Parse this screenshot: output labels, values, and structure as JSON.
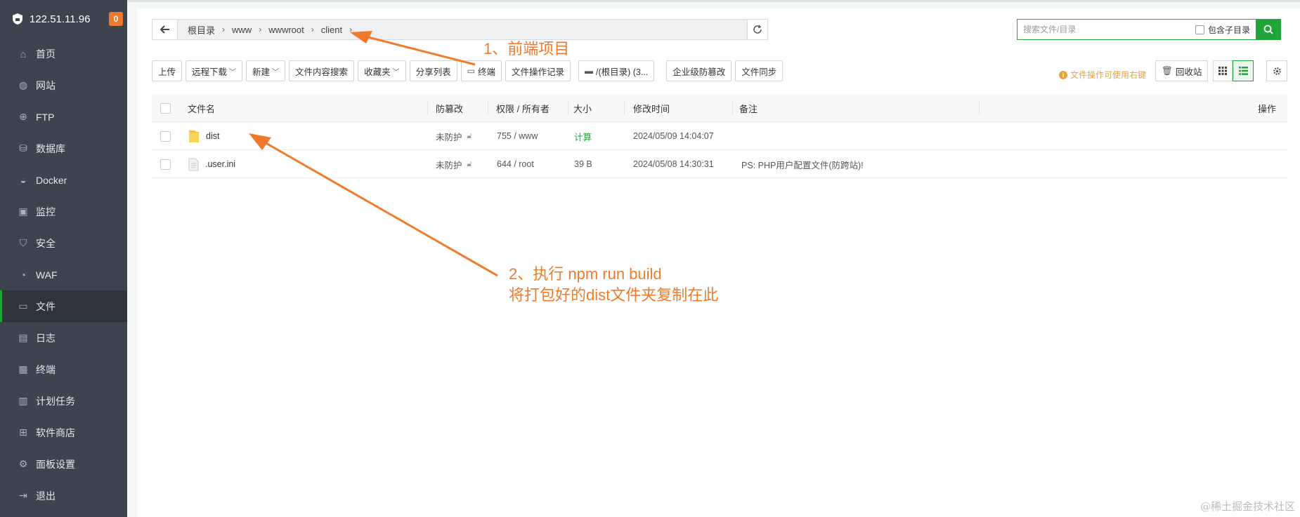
{
  "sidebar": {
    "ip": "122.51.11.96",
    "badge": "0",
    "items": [
      {
        "label": "首页",
        "icon": "home-icon"
      },
      {
        "label": "网站",
        "icon": "globe-icon"
      },
      {
        "label": "FTP",
        "icon": "ftp-icon"
      },
      {
        "label": "数据库",
        "icon": "database-icon"
      },
      {
        "label": "Docker",
        "icon": "docker-icon"
      },
      {
        "label": "监控",
        "icon": "monitor-icon"
      },
      {
        "label": "安全",
        "icon": "shield-icon"
      },
      {
        "label": "WAF",
        "icon": "waf-icon"
      },
      {
        "label": "文件",
        "icon": "folder-icon"
      },
      {
        "label": "日志",
        "icon": "log-icon"
      },
      {
        "label": "终端",
        "icon": "terminal-icon"
      },
      {
        "label": "计划任务",
        "icon": "calendar-icon"
      },
      {
        "label": "软件商店",
        "icon": "store-icon"
      },
      {
        "label": "面板设置",
        "icon": "gear-icon"
      },
      {
        "label": "退出",
        "icon": "logout-icon"
      }
    ],
    "active_index": 8
  },
  "path": {
    "crumbs": [
      "根目录",
      "www",
      "wwwroot",
      "client"
    ]
  },
  "search": {
    "placeholder": "搜索文件/目录",
    "include_subdir": "包含子目录"
  },
  "toolbar": {
    "upload": "上传",
    "remote_download": "远程下载",
    "new": "新建",
    "content_search": "文件内容搜索",
    "favorites": "收藏夹",
    "share_list": "分享列表",
    "terminal": "终端",
    "operation_log": "文件操作记录",
    "disk": "/(根目录) (3...",
    "tamper_proof": "企业级防篡改",
    "file_sync": "文件同步",
    "hint": "文件操作可使用右键",
    "recycle": "回收站"
  },
  "table": {
    "headers": {
      "name": "文件名",
      "tamper": "防篡改",
      "perm": "权限 / 所有者",
      "size": "大小",
      "mtime": "修改时间",
      "remark": "备注",
      "ops": "操作"
    },
    "rows": [
      {
        "name": "dist",
        "type": "folder",
        "tamper": "未防护",
        "perm": "755 / www",
        "size": "计算",
        "mtime": "2024/05/09 14:04:07",
        "remark": ""
      },
      {
        "name": ".user.ini",
        "type": "file",
        "tamper": "未防护",
        "perm": "644 / root",
        "size": "39 B",
        "mtime": "2024/05/08 14:30:31",
        "remark": "PS: PHP用户配置文件(防跨站)!"
      }
    ]
  },
  "annotations": {
    "step1": "1、前端项目",
    "step2_line1": "2、执行 npm run build",
    "step2_line2": "将打包好的dist文件夹复制在此"
  },
  "colors": {
    "accent": "#20a53a",
    "annotation": "#f07a2a",
    "sidebar_bg": "#3c444d",
    "badge": "#f0772f"
  },
  "watermark": "@稀土掘金技术社区"
}
